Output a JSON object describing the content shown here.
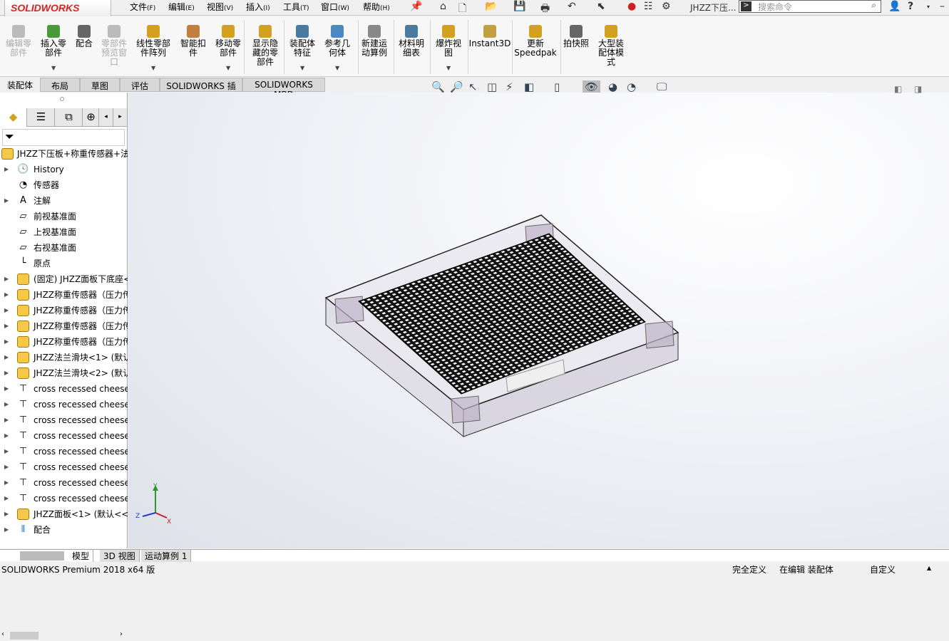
{
  "app": {
    "logo": "SOLIDWORKS",
    "doc_title": "JHZZ下压...",
    "search_placeholder": "搜索命令"
  },
  "menu": [
    {
      "label": "文件",
      "key": "(F)"
    },
    {
      "label": "编辑",
      "key": "(E)"
    },
    {
      "label": "视图",
      "key": "(V)"
    },
    {
      "label": "插入",
      "key": "(I)"
    },
    {
      "label": "工具",
      "key": "(T)"
    },
    {
      "label": "窗口",
      "key": "(W)"
    },
    {
      "label": "帮助",
      "key": "(H)"
    }
  ],
  "quick_access": [
    "home-icon",
    "new-icon",
    "open-icon",
    "save-icon",
    "print-icon",
    "undo-icon",
    "select-icon",
    "rebuild-icon",
    "file-properties-icon",
    "options-icon"
  ],
  "ribbon": [
    {
      "label": "编辑零\n部件",
      "enabled": false,
      "color": "#bbbbbb"
    },
    {
      "label": "插入零\n部件",
      "enabled": true,
      "color": "#4a9a3a"
    },
    {
      "label": "配合",
      "enabled": true,
      "color": "#666666"
    },
    {
      "label": "零部件\n预览窗\n口",
      "enabled": false,
      "color": "#bbbbbb"
    },
    {
      "label": "线性零部\n件阵列",
      "enabled": true,
      "color": "#d4a020"
    },
    {
      "label": "智能扣\n件",
      "enabled": true,
      "color": "#c08040"
    },
    {
      "label": "移动零\n部件",
      "enabled": true,
      "color": "#d4a020"
    },
    {
      "label": "显示隐\n藏的零\n部件",
      "enabled": true,
      "color": "#d4a020"
    },
    {
      "label": "装配体\n特征",
      "enabled": true,
      "color": "#4a7aa0"
    },
    {
      "label": "参考几\n何体",
      "enabled": true,
      "color": "#4a8ac0"
    },
    {
      "label": "新建运\n动算例",
      "enabled": true,
      "color": "#888888"
    },
    {
      "label": "材料明\n细表",
      "enabled": true,
      "color": "#4a7aa0"
    },
    {
      "label": "爆炸视\n图",
      "enabled": true,
      "color": "#d4a020"
    },
    {
      "label": "Instant3D",
      "enabled": true,
      "color": "#c0a040"
    },
    {
      "label": "更新\nSpeedpak",
      "enabled": true,
      "color": "#d4a020"
    },
    {
      "label": "拍快照",
      "enabled": true,
      "color": "#666666"
    },
    {
      "label": "大型装\n配体模\n式",
      "enabled": true,
      "color": "#d4a020"
    }
  ],
  "tabs": [
    "装配体",
    "布局",
    "草图",
    "评估",
    "SOLIDWORKS 插件",
    "SOLIDWORKS MBD"
  ],
  "view_toolbar": [
    "zoom-to-fit-icon",
    "zoom-area-icon",
    "previous-view-icon",
    "section-view-icon",
    "dynamic-annotation-icon",
    "view-orientation-icon",
    "display-style-icon",
    "hide-show-icon",
    "edit-appearance-icon",
    "apply-scene-icon",
    "view-settings-icon"
  ],
  "tree": {
    "root": "JHZZ下压板+称重传感器+法",
    "items": [
      {
        "label": "History",
        "icon": "history-folder-icon",
        "expand": true
      },
      {
        "label": "传感器",
        "icon": "sensor-folder-icon",
        "expand": false
      },
      {
        "label": "注解",
        "icon": "annotation-folder-icon",
        "expand": true
      },
      {
        "label": "前视基准面",
        "icon": "plane-icon",
        "expand": false
      },
      {
        "label": "上视基准面",
        "icon": "plane-icon",
        "expand": false
      },
      {
        "label": "右视基准面",
        "icon": "plane-icon",
        "expand": false
      },
      {
        "label": "原点",
        "icon": "origin-icon",
        "expand": false
      },
      {
        "label": "(固定) JHZZ面板下底座<",
        "icon": "part-icon",
        "expand": true
      },
      {
        "label": "JHZZ称重传感器（压力传",
        "icon": "part-icon",
        "expand": true
      },
      {
        "label": "JHZZ称重传感器（压力传",
        "icon": "part-icon",
        "expand": true
      },
      {
        "label": "JHZZ称重传感器（压力传",
        "icon": "part-icon",
        "expand": true
      },
      {
        "label": "JHZZ称重传感器（压力传",
        "icon": "part-icon",
        "expand": true
      },
      {
        "label": "JHZZ法兰滑块<1> (默认",
        "icon": "part-icon",
        "expand": true
      },
      {
        "label": "JHZZ法兰滑块<2> (默认",
        "icon": "part-icon",
        "expand": true
      },
      {
        "label": "cross recessed cheese",
        "icon": "screw-icon",
        "expand": true
      },
      {
        "label": "cross recessed cheese",
        "icon": "screw-icon",
        "expand": true
      },
      {
        "label": "cross recessed cheese",
        "icon": "screw-icon",
        "expand": true
      },
      {
        "label": "cross recessed cheese",
        "icon": "screw-icon",
        "expand": true
      },
      {
        "label": "cross recessed cheese",
        "icon": "screw-icon",
        "expand": true
      },
      {
        "label": "cross recessed cheese",
        "icon": "screw-icon",
        "expand": true
      },
      {
        "label": "cross recessed cheese",
        "icon": "screw-icon",
        "expand": true
      },
      {
        "label": "cross recessed cheese",
        "icon": "screw-icon",
        "expand": true
      },
      {
        "label": "JHZZ面板<1> (默认<<默",
        "icon": "part-icon",
        "expand": true
      },
      {
        "label": "配合",
        "icon": "mates-icon",
        "expand": true
      }
    ]
  },
  "triad": {
    "x": "X",
    "y": "Y",
    "z": "Z"
  },
  "bottom_tabs": [
    "模型",
    "3D 视图",
    "运动算例 1"
  ],
  "status": {
    "left": "SOLIDWORKS Premium 2018 x64 版",
    "definition": "完全定义",
    "editing": "在编辑 装配体",
    "custom": "自定义"
  }
}
